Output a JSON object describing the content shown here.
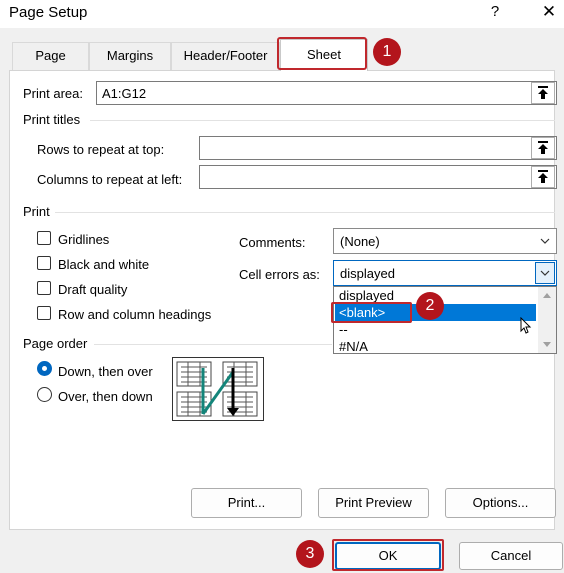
{
  "window": {
    "title": "Page Setup",
    "help": "?",
    "close": "✕"
  },
  "tabs": [
    "Page",
    "Margins",
    "Header/Footer",
    "Sheet"
  ],
  "print_area": {
    "label": "Print area:",
    "value": "A1:G12"
  },
  "print_titles": {
    "heading": "Print titles",
    "rows_label": "Rows to repeat at top:",
    "rows_value": "",
    "cols_label": "Columns to repeat at left:",
    "cols_value": ""
  },
  "print": {
    "heading": "Print",
    "gridlines": "Gridlines",
    "black_white": "Black and white",
    "draft": "Draft quality",
    "headings": "Row and column headings",
    "comments_label": "Comments:",
    "comments_value": "(None)",
    "errors_label": "Cell errors as:",
    "errors_value": "displayed"
  },
  "dropdown_options": [
    "displayed",
    "<blank>",
    "--",
    "#N/A"
  ],
  "dropdown_selected": 1,
  "page_order": {
    "heading": "Page order",
    "down_over": "Down, then over",
    "over_down": "Over, then down",
    "selected": "Down, then over"
  },
  "buttons": {
    "print": "Print...",
    "preview": "Print Preview",
    "options": "Options...",
    "ok": "OK",
    "cancel": "Cancel"
  },
  "badges": [
    "1",
    "2",
    "3"
  ],
  "colors": {
    "badge": "#b3151c",
    "highlight": "#c0282d",
    "accent": "#0067c0",
    "selection": "#0078d7"
  }
}
